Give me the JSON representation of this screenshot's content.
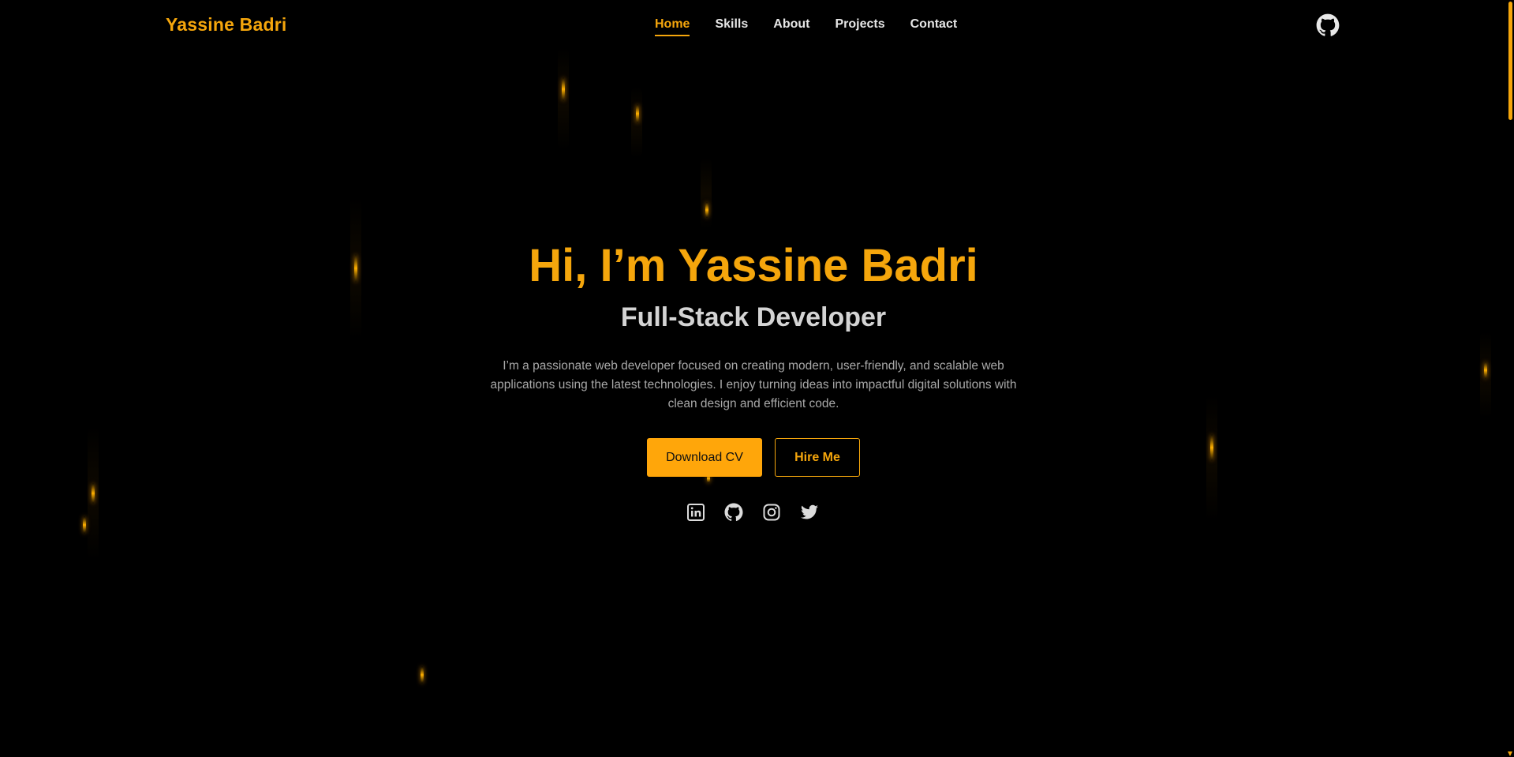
{
  "navbar": {
    "brand": "Yassine Badri",
    "links": [
      {
        "label": "Home",
        "active": true
      },
      {
        "label": "Skills"
      },
      {
        "label": "About"
      },
      {
        "label": "Projects"
      },
      {
        "label": "Contact"
      }
    ],
    "github_icon": "github-icon"
  },
  "hero": {
    "title": "Hi, I’m Yassine Badri",
    "subtitle": "Full-Stack Developer",
    "description": "I’m a passionate web developer focused on creating modern, user-friendly, and scalable web applications using the latest technologies. I enjoy turning ideas into impactful digital solutions with clean design and efficient code.",
    "primary_button": "Download CV",
    "secondary_button": "Hire Me",
    "socials": [
      "linkedin-icon",
      "github-icon",
      "instagram-icon",
      "twitter-icon"
    ]
  },
  "colors": {
    "accent": "#f5a60c",
    "background": "#000000",
    "text_light": "#d4d4d4",
    "text_muted": "#a8a8a8"
  }
}
